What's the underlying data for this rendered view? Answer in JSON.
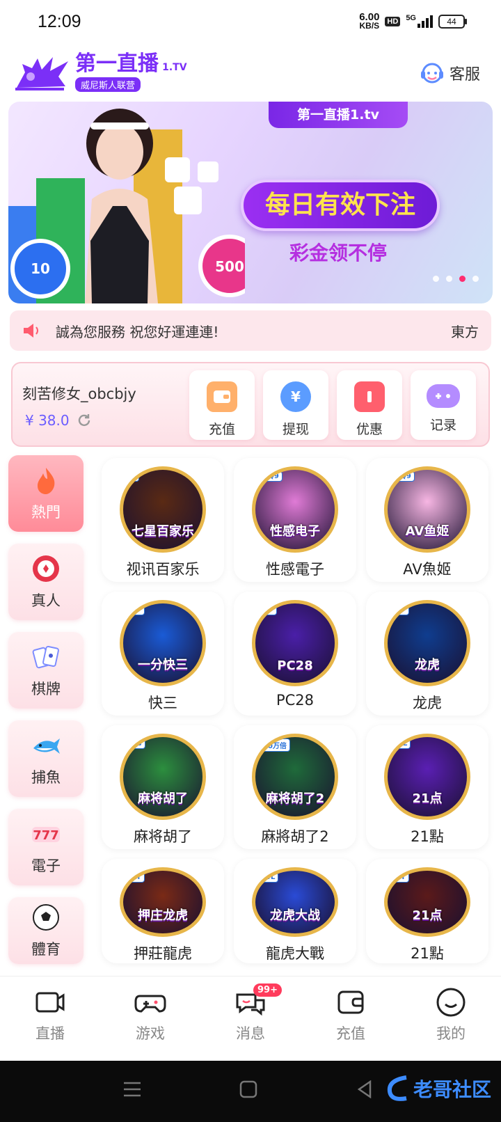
{
  "status_bar": {
    "time": "12:09",
    "net_speed": "6.00",
    "net_unit": "KB/S",
    "hd": "HD",
    "network": "5G",
    "battery": "44"
  },
  "header": {
    "logo_main": "第一直播",
    "logo_tv": "1.TV",
    "logo_sub": "威尼斯人联营",
    "service_label": "客服"
  },
  "banner": {
    "tag": "第一直播1.tv",
    "headline": "每日有效下注",
    "subline": "彩金领不停",
    "chips": [
      "10",
      "500"
    ],
    "slides": 4,
    "active_slide": 3
  },
  "notice": {
    "text": "誠為您服務 祝您好運連連!",
    "trailing": "東方"
  },
  "wallet": {
    "username": "刻苦修女_obcbjy",
    "balance": "¥ 38.0",
    "actions": [
      {
        "label": "充值",
        "icon": "wallet-icon",
        "color": "#ffb06b"
      },
      {
        "label": "提现",
        "icon": "yen-coin-icon",
        "color": "#5b9cff"
      },
      {
        "label": "优惠",
        "icon": "coupon-icon",
        "color": "#ff5f6d"
      },
      {
        "label": "记录",
        "icon": "gamepad-icon",
        "color": "#b48cff"
      }
    ]
  },
  "categories": [
    {
      "label": "熱門",
      "icon": "flame-icon"
    },
    {
      "label": "真人",
      "icon": "casino-chip-icon"
    },
    {
      "label": "棋牌",
      "icon": "playing-cards-icon"
    },
    {
      "label": "捕魚",
      "icon": "shark-icon"
    },
    {
      "label": "電子",
      "icon": "slot-777-icon"
    },
    {
      "label": "體育",
      "icon": "soccer-ball-icon"
    }
  ],
  "games": [
    {
      "name": "视讯百家乐",
      "badge": "七星百家乐",
      "provider": "S",
      "bg": "#5a2a14"
    },
    {
      "name": "性感電子",
      "badge": "性感电子",
      "provider": "CQ9",
      "bg": "#e07bd6"
    },
    {
      "name": "AV魚姬",
      "badge": "AV鱼姬",
      "provider": "CQ9",
      "bg": "#f7b6e3"
    },
    {
      "name": "快三",
      "badge": "一分快三",
      "provider": "DF",
      "bg": "#1a5bd6"
    },
    {
      "name": "PC28",
      "badge": "PC28",
      "provider": "DF",
      "bg": "#4a1fa8"
    },
    {
      "name": "龙虎",
      "badge": "龙虎",
      "provider": "DF",
      "bg": "#0f3d8f"
    },
    {
      "name": "麻将胡了",
      "badge": "麻将胡了",
      "provider": "PG",
      "bg": "#2c8f3e"
    },
    {
      "name": "麻將胡了2",
      "badge": "麻将胡了2",
      "provider": "10万倍",
      "bg": "#1f6b3a"
    },
    {
      "name": "21點",
      "badge": "21点",
      "provider": "WL",
      "bg": "#5a1fb3"
    },
    {
      "name": "押莊龍虎",
      "badge": "押庄龙虎",
      "provider": "KY",
      "bg": "#7a2a16"
    },
    {
      "name": "龍虎大戰",
      "badge": "龙虎大战",
      "provider": "WL",
      "bg": "#2a4bd6"
    },
    {
      "name": "21點",
      "badge": "21点",
      "provider": "KY",
      "bg": "#5b1a1a"
    }
  ],
  "tabbar": [
    {
      "label": "直播",
      "icon": "video-camera-icon"
    },
    {
      "label": "游戏",
      "icon": "gamepad-icon"
    },
    {
      "label": "消息",
      "icon": "chat-bubbles-icon",
      "badge": "99+"
    },
    {
      "label": "充值",
      "icon": "wallet-icon"
    },
    {
      "label": "我的",
      "icon": "smiley-icon"
    }
  ],
  "watermark": "老哥社区",
  "colors": {
    "accent": "#7b2ff7",
    "pink": "#ff8b98",
    "balance": "#6b5cff",
    "badge": "#ff3b5c"
  }
}
